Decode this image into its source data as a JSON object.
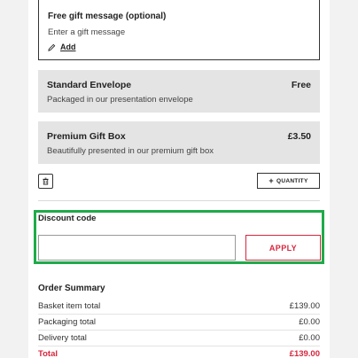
{
  "gift_message": {
    "title": "Free gift message (optional)",
    "placeholder": "Enter a gift message",
    "add_label": "Add"
  },
  "packaging_options": [
    {
      "name": "Standard Envelope",
      "description": "Packaged in our presentation envelope",
      "price": "Free"
    },
    {
      "name": "Premium Gift Box",
      "description": "Beautifully presented in our premium gift box",
      "price": "£3.50"
    }
  ],
  "item_actions": {
    "quantity_label": "QUANTITY",
    "plus_symbol": "+"
  },
  "discount": {
    "label": "Discount code",
    "input_value": "",
    "apply_label": "APPLY",
    "highlight_color": "#1faa4a"
  },
  "order_summary": {
    "title": "Order Summary",
    "rows": [
      {
        "label": "Basket item total",
        "value": "£139.00"
      },
      {
        "label": "Packaging total",
        "value": "£0.00"
      },
      {
        "label": "Delivery total",
        "value": "£0.00"
      }
    ],
    "total": {
      "label": "Total",
      "value": "£139.00"
    }
  },
  "colors": {
    "accent_red": "#d7263d",
    "panel_grey": "#e4e4e4",
    "page_bg": "#f2f2f2"
  }
}
